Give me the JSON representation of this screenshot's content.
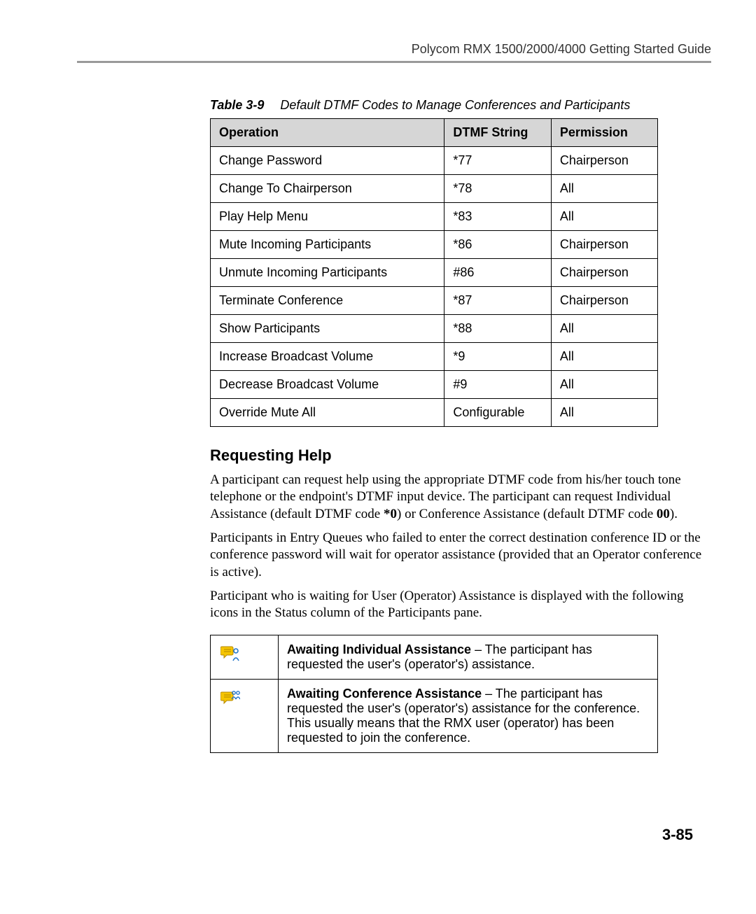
{
  "header": "Polycom RMX 1500/2000/4000 Getting Started Guide",
  "table": {
    "caption_label": "Table 3-9",
    "caption_text": "Default DTMF Codes to Manage Conferences and Participants",
    "headers": {
      "operation": "Operation",
      "dtmf": "DTMF String",
      "permission": "Permission"
    },
    "rows": [
      {
        "operation": "Change Password",
        "dtmf": "*77",
        "permission": "Chairperson"
      },
      {
        "operation": "Change To Chairperson",
        "dtmf": "*78",
        "permission": "All"
      },
      {
        "operation": "Play Help Menu",
        "dtmf": "*83",
        "permission": "All"
      },
      {
        "operation": "Mute Incoming Participants",
        "dtmf": "*86",
        "permission": "Chairperson"
      },
      {
        "operation": "Unmute Incoming Participants",
        "dtmf": "#86",
        "permission": "Chairperson"
      },
      {
        "operation": "Terminate Conference",
        "dtmf": "*87",
        "permission": "Chairperson"
      },
      {
        "operation": "Show Participants",
        "dtmf": "*88",
        "permission": "All"
      },
      {
        "operation": "Increase Broadcast Volume",
        "dtmf": "*9",
        "permission": "All"
      },
      {
        "operation": "Decrease Broadcast Volume",
        "dtmf": "#9",
        "permission": "All"
      },
      {
        "operation": "Override Mute All",
        "dtmf": "Configurable",
        "permission": "All"
      }
    ]
  },
  "section": {
    "heading": "Requesting Help",
    "p1_a": "A participant can request help using the appropriate DTMF code from his/her touch tone telephone or the endpoint's DTMF input device. The participant can request Individual Assistance (default DTMF code ",
    "p1_b": "*0",
    "p1_c": ") or Conference Assistance (default DTMF code ",
    "p1_d": "00",
    "p1_e": ").",
    "p2": "Participants in Entry Queues who failed to enter the correct destination conference ID or the conference password will wait for operator assistance (provided that an Operator conference is active).",
    "p3": "Participant who is waiting for User (Operator) Assistance is displayed with the following icons in the Status column of the Participants pane."
  },
  "assistance": {
    "r1_bold": "Awaiting Individual Assistance",
    "r1_text": " – The participant has requested the user's (operator's) assistance.",
    "r2_bold": "Awaiting Conference Assistance",
    "r2_text": " – The participant has requested the user's (operator's) assistance for the conference. This usually means that the RMX user (operator) has been requested to join the conference."
  },
  "page_number": "3-85"
}
